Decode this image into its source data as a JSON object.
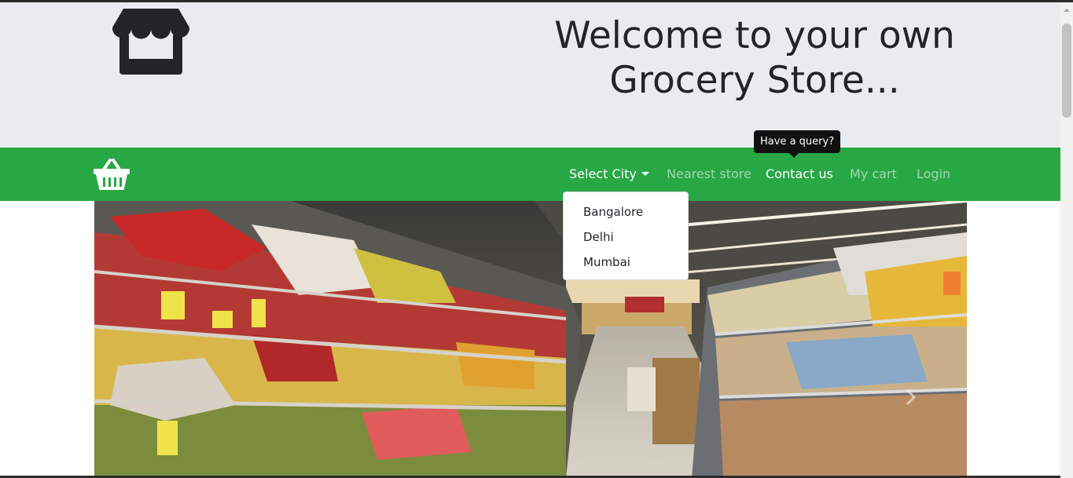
{
  "header": {
    "logo_icon": "storefront-icon",
    "title_line1": "Welcome to your own",
    "title_line2": "Grocery Store..."
  },
  "navbar": {
    "brand_icon": "shopping-basket-icon",
    "links": [
      {
        "label": "Select City",
        "state": "active-dropdown"
      },
      {
        "label": "Nearest store",
        "state": "muted"
      },
      {
        "label": "Contact us",
        "state": "hover"
      },
      {
        "label": "My cart",
        "state": "muted"
      },
      {
        "label": "Login",
        "state": "muted"
      }
    ],
    "tooltip": "Have a query?",
    "dropdown_items": [
      "Bangalore",
      "Delhi",
      "Mumbai"
    ]
  },
  "hero": {
    "image": "supermarket-aisle-photo",
    "next_control_icon": "chevron-right-icon"
  },
  "colors": {
    "header_bg": "#e9ecef",
    "navbar_bg": "#28a745",
    "text_dark": "#212529",
    "tooltip_bg": "#111111"
  }
}
